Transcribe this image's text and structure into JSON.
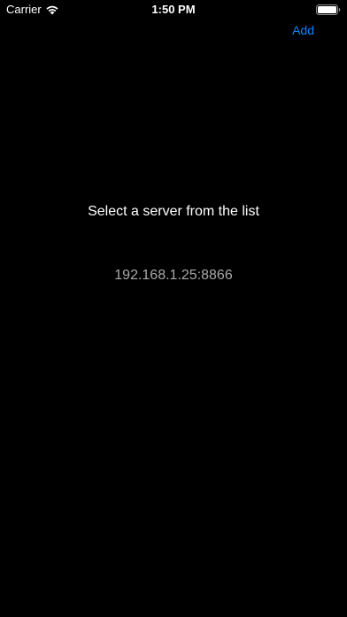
{
  "status_bar": {
    "carrier": "Carrier",
    "time": "1:50 PM",
    "wifi_icon": "wifi-icon",
    "battery_icon": "battery-icon"
  },
  "nav": {
    "add_label": "Add"
  },
  "main": {
    "prompt": "Select a server from the list",
    "servers": [
      "192.168.1.25:8866"
    ]
  },
  "colors": {
    "background": "#000000",
    "accent": "#0a84ff",
    "secondary_text": "#a8a8a8",
    "primary_text": "#ffffff"
  }
}
